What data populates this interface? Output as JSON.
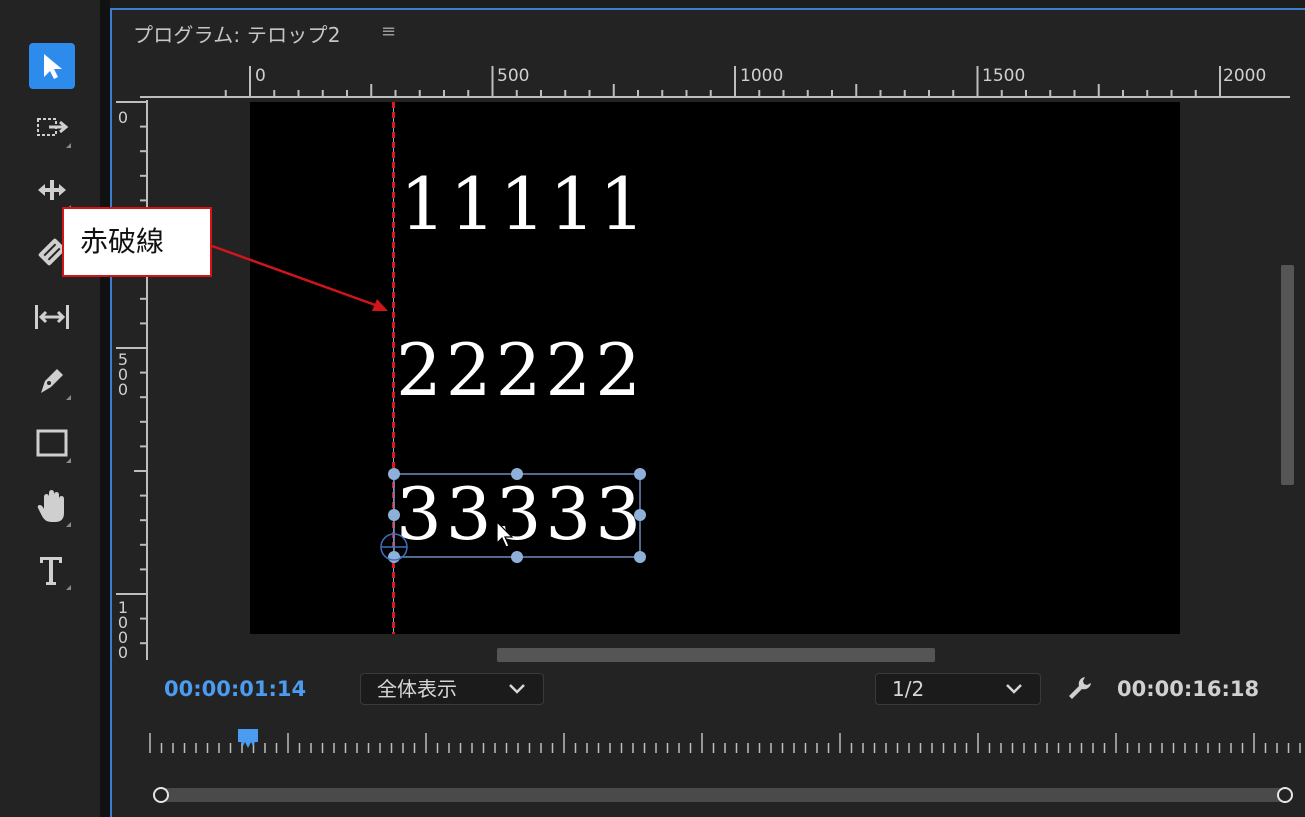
{
  "panel": {
    "title": "プログラム: テロップ2",
    "menu_icon": "hamburger-icon"
  },
  "toolbar": {
    "tools": [
      {
        "name": "selection-tool",
        "icon": "arrow-cursor-icon",
        "active": true
      },
      {
        "name": "track-select-tool",
        "icon": "track-select-icon"
      },
      {
        "name": "ripple-edit-tool",
        "icon": "ripple-edit-icon"
      },
      {
        "name": "razor-tool",
        "icon": "razor-icon"
      },
      {
        "name": "slip-tool",
        "icon": "slip-icon"
      },
      {
        "name": "pen-tool",
        "icon": "pen-icon"
      },
      {
        "name": "rectangle-tool",
        "icon": "rectangle-icon"
      },
      {
        "name": "hand-tool",
        "icon": "hand-icon"
      },
      {
        "name": "type-tool",
        "icon": "type-icon"
      }
    ]
  },
  "ruler": {
    "horizontal_labels": [
      "0",
      "500",
      "1000",
      "1500",
      "2000"
    ],
    "vertical_labels": [
      "0",
      "500",
      "1000"
    ]
  },
  "canvas": {
    "lines": [
      "11111",
      "22222",
      "33333"
    ]
  },
  "callout": {
    "text": "赤破線"
  },
  "transport": {
    "current_timecode": "00:00:01:14",
    "zoom_select": "全体表示",
    "resolution_select": "1/2",
    "duration_timecode": "00:00:16:18"
  },
  "colors": {
    "accent": "#3b7ed0",
    "timecode_blue": "#4b9cf0",
    "guide_red": "#e0161d",
    "selection_handle": "#8fb0d8",
    "canvas": "#000000"
  }
}
